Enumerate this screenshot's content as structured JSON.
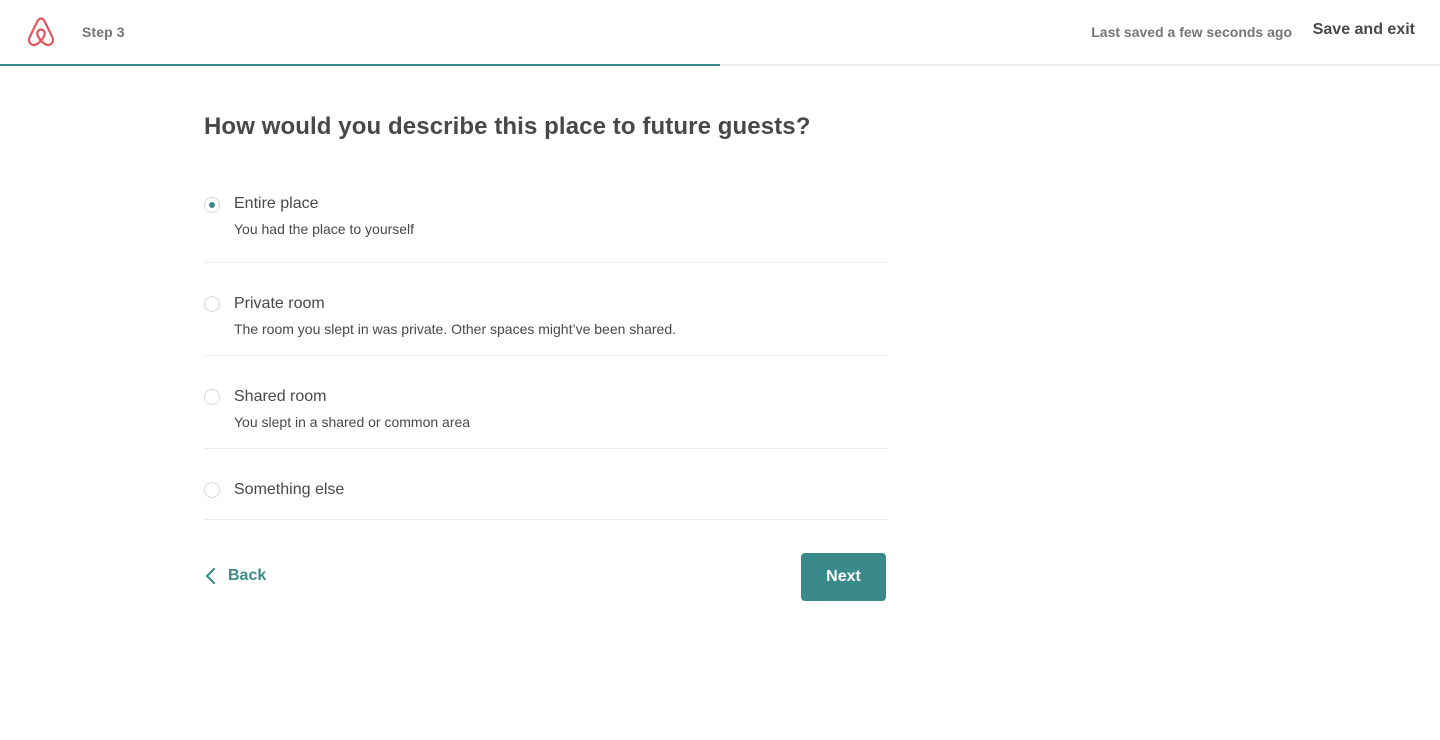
{
  "header": {
    "step_label": "Step 3",
    "saved_status": "Last saved a few seconds ago",
    "save_exit_label": "Save and exit",
    "progress_fraction": 0.5
  },
  "main": {
    "question": "How would you describe this place to future guests?",
    "options": [
      {
        "title": "Entire place",
        "description": "You had the place to yourself",
        "selected": true
      },
      {
        "title": "Private room",
        "description": "The room you slept in was private. Other spaces might’ve been shared.",
        "selected": false
      },
      {
        "title": "Shared room",
        "description": "You slept in a shared or common area",
        "selected": false
      },
      {
        "title": "Something else",
        "description": "",
        "selected": false
      }
    ]
  },
  "footer": {
    "back_label": "Back",
    "next_label": "Next"
  },
  "colors": {
    "accent": "#3b8a8b",
    "brand": "#e0565b",
    "text": "#484848",
    "muted": "#767676"
  },
  "icons": {
    "logo": "airbnb-logo-icon",
    "back": "chevron-left-icon"
  }
}
